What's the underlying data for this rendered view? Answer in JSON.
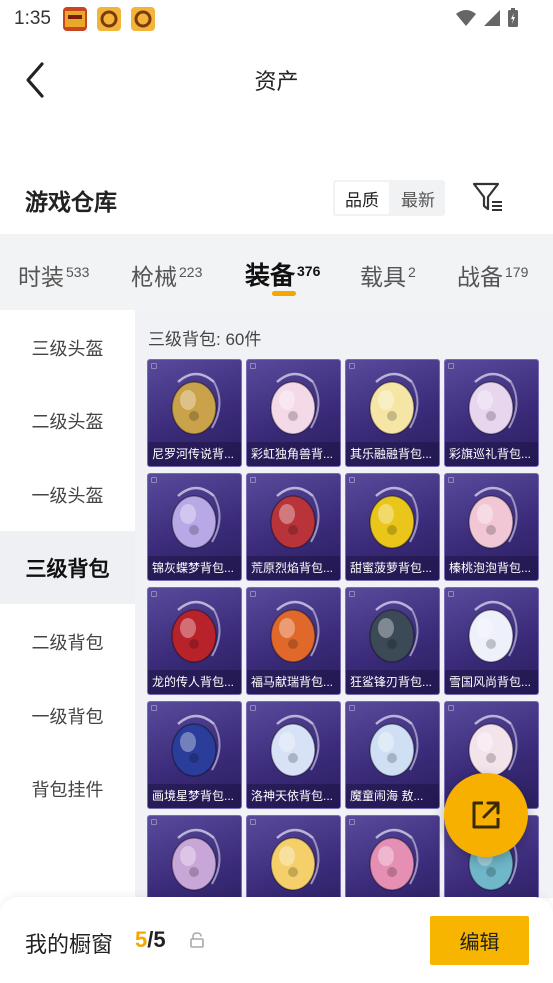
{
  "status": {
    "time": "1:35"
  },
  "header": {
    "title": "资产"
  },
  "warehouse": {
    "title": "游戏仓库",
    "sort_options": [
      {
        "label": "品质",
        "active": true
      },
      {
        "label": "最新",
        "active": false
      }
    ]
  },
  "tabs": [
    {
      "label": "时装",
      "count": "533"
    },
    {
      "label": "枪械",
      "count": "223"
    },
    {
      "label": "装备",
      "count": "376",
      "active": true
    },
    {
      "label": "载具",
      "count": "2"
    },
    {
      "label": "战备",
      "count": "179"
    }
  ],
  "sidenav": [
    {
      "label": "三级头盔"
    },
    {
      "label": "二级头盔"
    },
    {
      "label": "一级头盔"
    },
    {
      "label": "三级背包",
      "active": true
    },
    {
      "label": "二级背包"
    },
    {
      "label": "一级背包"
    },
    {
      "label": "背包挂件"
    }
  ],
  "grid": {
    "header": "三级背包: 60件",
    "items": [
      {
        "label": "尼罗河传说背...",
        "icon": "pharaoh-backpack-icon",
        "color": "#c9a24a"
      },
      {
        "label": "彩虹独角兽背...",
        "icon": "unicorn-backpack-icon",
        "color": "#f4d9e8"
      },
      {
        "label": "其乐融融背包...",
        "icon": "bunny-backpack-icon",
        "color": "#f6e6a6"
      },
      {
        "label": "彩旗巡礼背包...",
        "icon": "ribbon-backpack-icon",
        "color": "#e7d6ee"
      },
      {
        "label": "锦灰蝶梦背包...",
        "icon": "butterfly-backpack-icon",
        "color": "#b9a8e6"
      },
      {
        "label": "荒原烈焰背包...",
        "icon": "flame-backpack-icon",
        "color": "#b8343a"
      },
      {
        "label": "甜蜜菠萝背包...",
        "icon": "pineapple-backpack-icon",
        "color": "#e9c619"
      },
      {
        "label": "榛桃泡泡背包...",
        "icon": "bow-backpack-icon",
        "color": "#f1c7d6"
      },
      {
        "label": "龙的传人背包...",
        "icon": "dragon-backpack-icon",
        "color": "#b8232b"
      },
      {
        "label": "福马献瑞背包...",
        "icon": "horse-backpack-icon",
        "color": "#e0682b"
      },
      {
        "label": "狂鲨锋刃背包...",
        "icon": "shark-backpack-icon",
        "color": "#3c4a57"
      },
      {
        "label": "雪国风尚背包...",
        "icon": "penguin-backpack-icon",
        "color": "#eef0fa"
      },
      {
        "label": "画境星梦背包...",
        "icon": "mirror-backpack-icon",
        "color": "#2a3d9a"
      },
      {
        "label": "洛神天依背包...",
        "icon": "angel-backpack-icon",
        "color": "#d8e2f6"
      },
      {
        "label": "魔童闹海 敖...",
        "icon": "orb-backpack-icon",
        "color": "#cfe0f5"
      },
      {
        "label": "",
        "icon": "sheep-backpack-icon",
        "color": "#f3e4ec"
      },
      {
        "label": "",
        "icon": "shell-backpack-icon",
        "color": "#c9a6d8"
      },
      {
        "label": "",
        "icon": "duck-backpack-icon",
        "color": "#f4cf6a"
      },
      {
        "label": "",
        "icon": "heart-backpack-icon",
        "color": "#e58fb5"
      },
      {
        "label": "",
        "icon": "crystal-backpack-icon",
        "color": "#6fb7c9"
      }
    ]
  },
  "showcase": {
    "label": "我的橱窗",
    "current": "5",
    "separator": "/",
    "total": "5"
  },
  "edit_button": {
    "label": "编辑"
  },
  "colors": {
    "accent": "#f7b500",
    "card_bg": "#3b2b7a"
  }
}
